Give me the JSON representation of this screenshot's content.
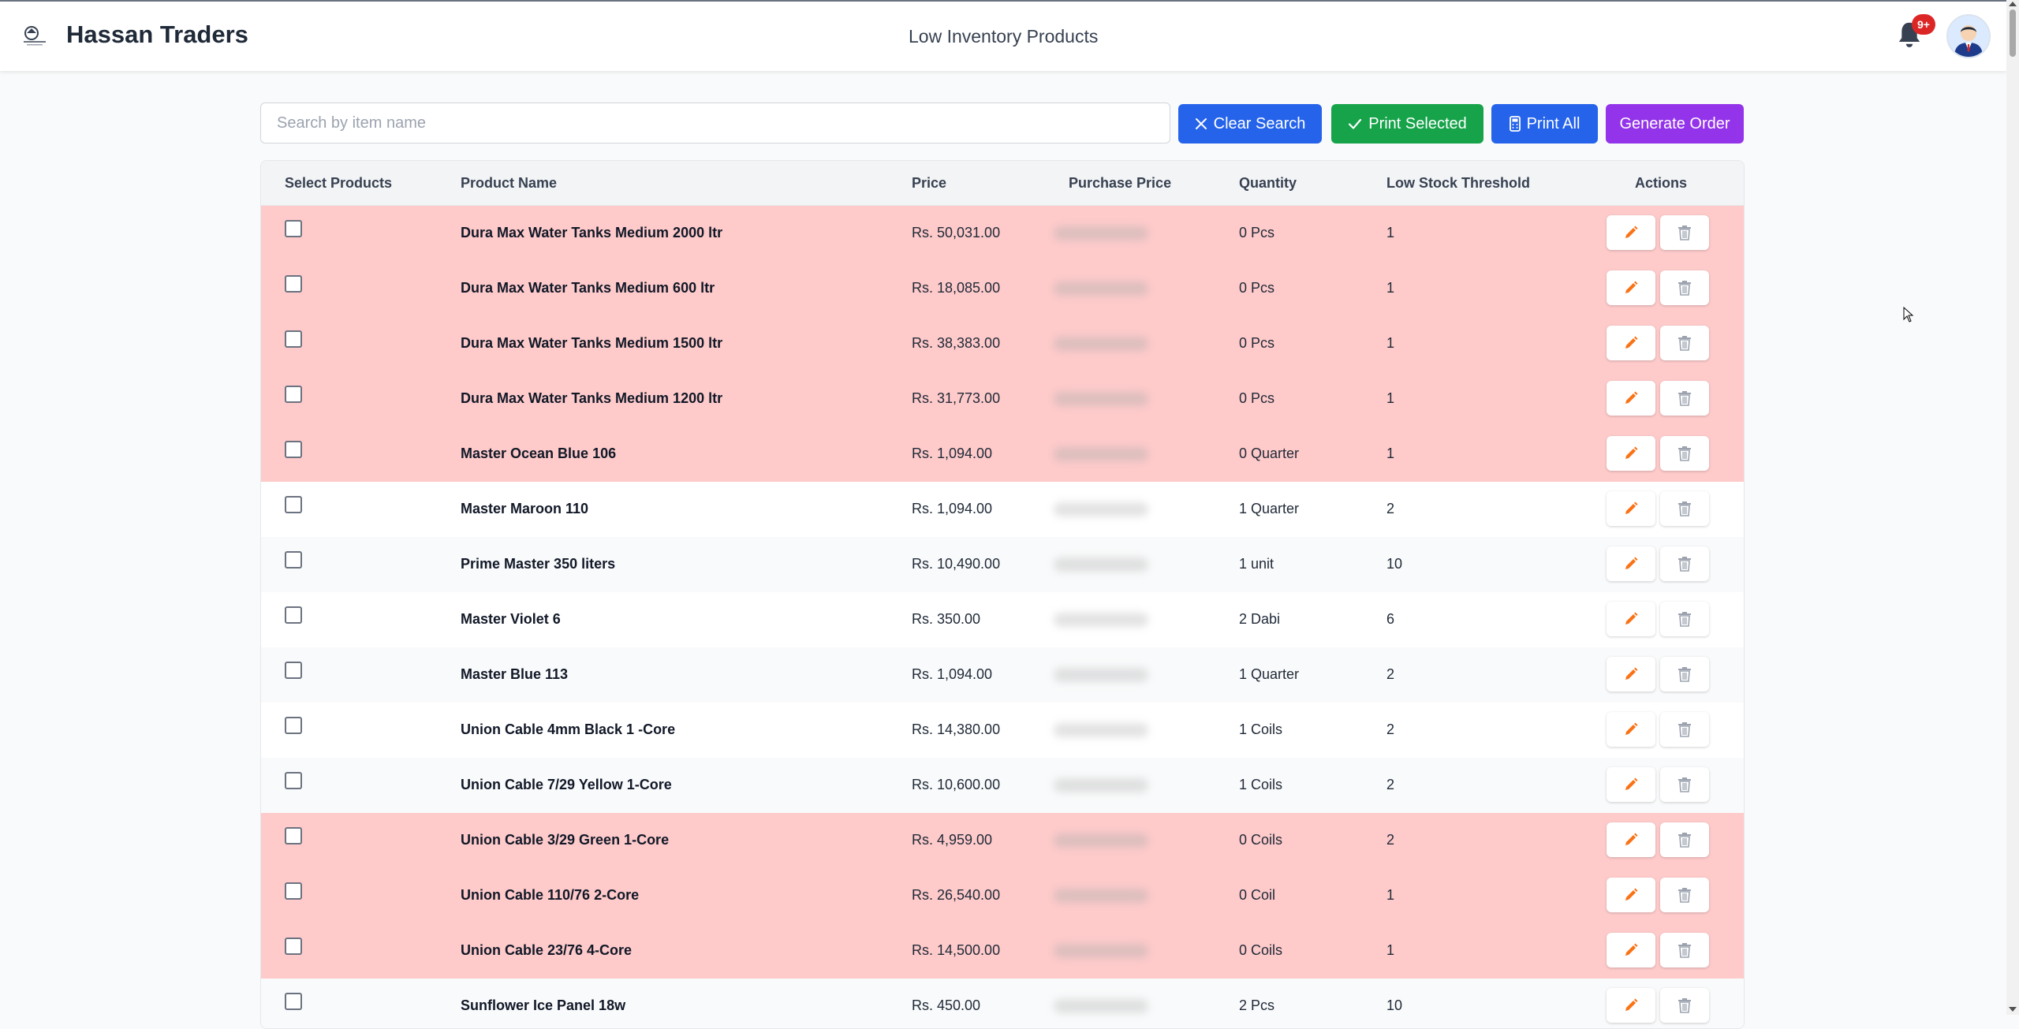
{
  "header": {
    "brand": "Hassan Traders",
    "page_title": "Low Inventory Products",
    "notification_badge": "9+"
  },
  "toolbar": {
    "search_placeholder": "Search by item name",
    "search_value": "",
    "clear_label": "Clear Search",
    "print_selected_label": "Print Selected",
    "print_all_label": "Print All",
    "generate_order_label": "Generate Order"
  },
  "table": {
    "columns": {
      "select": "Select Products",
      "name": "Product Name",
      "price": "Price",
      "purchase_price": "Purchase Price",
      "quantity": "Quantity",
      "threshold": "Low Stock Threshold",
      "actions": "Actions"
    },
    "rows": [
      {
        "name": "Dura Max Water Tanks Medium 2000 ltr",
        "price": "Rs. 50,031.00",
        "quantity": "0 Pcs",
        "threshold": "1",
        "out_of_stock": true
      },
      {
        "name": "Dura Max Water Tanks Medium 600 ltr",
        "price": "Rs. 18,085.00",
        "quantity": "0 Pcs",
        "threshold": "1",
        "out_of_stock": true
      },
      {
        "name": "Dura Max Water Tanks Medium 1500 ltr",
        "price": "Rs. 38,383.00",
        "quantity": "0 Pcs",
        "threshold": "1",
        "out_of_stock": true
      },
      {
        "name": "Dura Max Water Tanks Medium 1200 ltr",
        "price": "Rs. 31,773.00",
        "quantity": "0 Pcs",
        "threshold": "1",
        "out_of_stock": true
      },
      {
        "name": "Master Ocean Blue 106",
        "price": "Rs. 1,094.00",
        "quantity": "0 Quarter",
        "threshold": "1",
        "out_of_stock": true
      },
      {
        "name": "Master Maroon 110",
        "price": "Rs. 1,094.00",
        "quantity": "1 Quarter",
        "threshold": "2",
        "out_of_stock": false
      },
      {
        "name": "Prime Master 350 liters",
        "price": "Rs. 10,490.00",
        "quantity": "1 unit",
        "threshold": "10",
        "out_of_stock": false
      },
      {
        "name": "Master Violet 6",
        "price": "Rs. 350.00",
        "quantity": "2 Dabi",
        "threshold": "6",
        "out_of_stock": false
      },
      {
        "name": "Master Blue 113",
        "price": "Rs. 1,094.00",
        "quantity": "1 Quarter",
        "threshold": "2",
        "out_of_stock": false
      },
      {
        "name": "Union Cable 4mm Black 1 -Core",
        "price": "Rs. 14,380.00",
        "quantity": "1 Coils",
        "threshold": "2",
        "out_of_stock": false
      },
      {
        "name": "Union Cable 7/29 Yellow 1-Core",
        "price": "Rs. 10,600.00",
        "quantity": "1 Coils",
        "threshold": "2",
        "out_of_stock": false
      },
      {
        "name": "Union Cable 3/29 Green 1-Core",
        "price": "Rs. 4,959.00",
        "quantity": "0 Coils",
        "threshold": "2",
        "out_of_stock": true
      },
      {
        "name": "Union Cable 110/76 2-Core",
        "price": "Rs. 26,540.00",
        "quantity": "0 Coil",
        "threshold": "1",
        "out_of_stock": true
      },
      {
        "name": "Union Cable 23/76 4-Core",
        "price": "Rs. 14,500.00",
        "quantity": "0 Coils",
        "threshold": "1",
        "out_of_stock": true
      },
      {
        "name": "Sunflower Ice Panel 18w",
        "price": "Rs. 450.00",
        "quantity": "2 Pcs",
        "threshold": "10",
        "out_of_stock": false
      }
    ]
  },
  "colors": {
    "low_row": "#fecaca",
    "clear_button": "#2563eb",
    "print_selected_button": "#16a34a",
    "print_all_button": "#2563eb",
    "generate_order_button": "#9333ea",
    "edit_icon": "#f97316",
    "delete_icon": "#9ca3af"
  },
  "icons": {
    "logo": "logo-icon",
    "notifications": "bell-icon",
    "clear": "close-icon",
    "print_selected": "check-icon",
    "print_all": "calculator-icon",
    "edit": "pencil-icon",
    "delete": "trash-icon"
  }
}
